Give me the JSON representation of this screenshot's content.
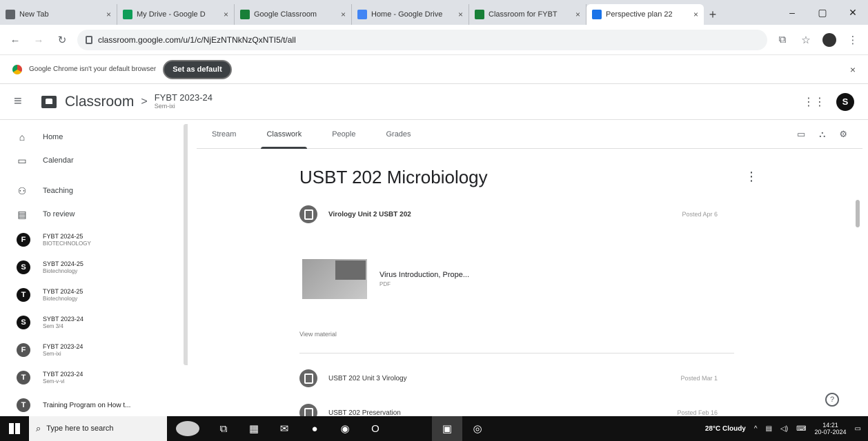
{
  "browser": {
    "tabs": [
      {
        "title": "New Tab",
        "color": "#5f6368",
        "active": false
      },
      {
        "title": "My Drive - Google D",
        "color": "#0f9d58",
        "active": false
      },
      {
        "title": "Google Classroom",
        "color": "#188038",
        "active": false
      },
      {
        "title": "Home - Google Drive",
        "color": "#4285f4",
        "active": false
      },
      {
        "title": "Classroom for FYBT",
        "color": "#188038",
        "active": false
      },
      {
        "title": "Perspective plan 22",
        "color": "#1a73e8",
        "active": true
      }
    ],
    "new_tab": "+",
    "window_controls": {
      "minimize": "–",
      "maximize": "▢",
      "close": "✕"
    },
    "url": "classroom.google.com/u/1/c/NjEzNTNkNzQxNTI5/t/all",
    "info_bar": {
      "message": "Google Chrome isn't your default browser",
      "button": "Set as default",
      "close": "×"
    }
  },
  "app": {
    "menu_glyph": "≡",
    "title": "Classroom",
    "breadcrumb_sep": ">",
    "class_name": "FYBT 2023-24",
    "class_section": "Sem-ixi",
    "apps_glyph": "⋮⋮⋮",
    "account_initial": "S"
  },
  "sidebar": {
    "nav": [
      {
        "label": "Home",
        "icon": "⌂"
      },
      {
        "label": "Calendar",
        "icon": "▭"
      },
      {
        "label": "Teaching",
        "icon": "⚇"
      },
      {
        "label": "To review",
        "icon": "▤"
      }
    ],
    "classes": [
      {
        "initial": "F",
        "name": "FYBT 2024-25",
        "section": "BIOTECHNOLOGY"
      },
      {
        "initial": "S",
        "name": "SYBT 2024-25",
        "section": "Biotechnology"
      },
      {
        "initial": "T",
        "name": "TYBT 2024-25",
        "section": "Biotechnology"
      },
      {
        "initial": "S",
        "name": "SYBT 2023-24",
        "section": "Sem 3/4"
      },
      {
        "initial": "F",
        "name": "FYBT 2023-24",
        "section": "Sem-ixi"
      },
      {
        "initial": "T",
        "name": "TYBT 2023-24",
        "section": "Sem-v-vi"
      }
    ],
    "last_item": {
      "initial": "T",
      "name": "Training Program on How t..."
    }
  },
  "tabs": {
    "items": [
      "Stream",
      "Classwork",
      "People",
      "Grades"
    ],
    "active": "Classwork"
  },
  "classwork": {
    "topic_title": "USBT 202 Microbiology",
    "topic_menu": "⋮",
    "items": [
      {
        "title": "Virology Unit 2 USBT 202",
        "date": "Posted Apr 6"
      },
      {
        "title": "USBT 202 Unit 3 Virology",
        "date": "Posted Mar 1"
      },
      {
        "title": "USBT 202 Preservation",
        "date": "Posted Feb 16"
      }
    ],
    "attachment": {
      "name": "Virus Introduction, Prope...",
      "type": "PDF"
    },
    "view_material": "View material"
  },
  "taskbar": {
    "search_placeholder": "Type here to search",
    "weather": "28°C Cloudy",
    "time": "14:21",
    "date": "20-07-2024"
  }
}
